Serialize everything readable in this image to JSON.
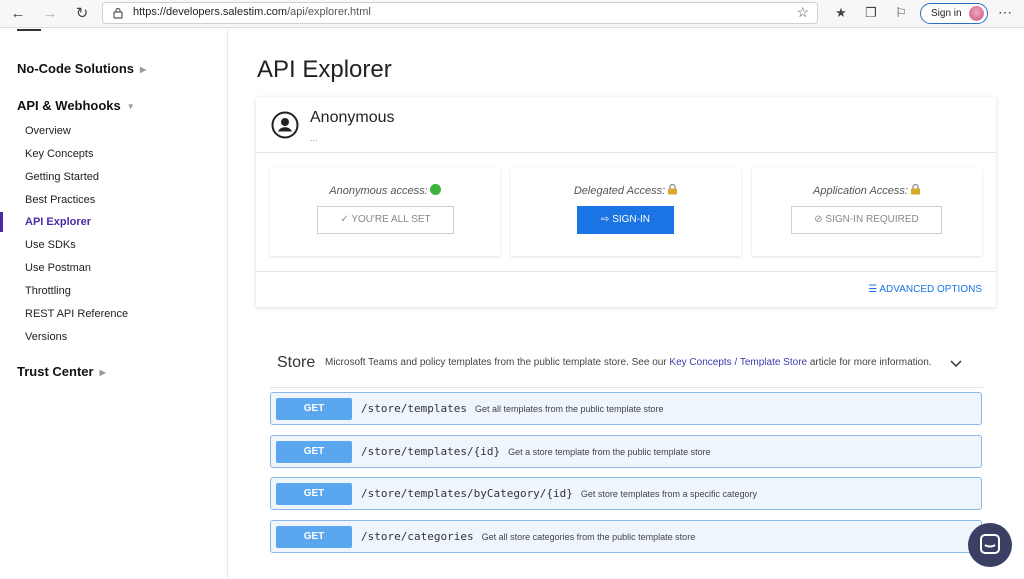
{
  "browser": {
    "url_host": "https://developers.salestim.com",
    "url_path": "/api/explorer.html",
    "signin_label": "Sign in"
  },
  "sidebar": {
    "sections": [
      {
        "label": "No-Code Solutions"
      },
      {
        "label": "API & Webhooks"
      },
      {
        "label": "Trust Center"
      }
    ],
    "items": [
      {
        "label": "Overview"
      },
      {
        "label": "Key Concepts"
      },
      {
        "label": "Getting Started"
      },
      {
        "label": "Best Practices"
      },
      {
        "label": "API Explorer",
        "active": true
      },
      {
        "label": "Use SDKs"
      },
      {
        "label": "Use Postman"
      },
      {
        "label": "Throttling"
      },
      {
        "label": "REST API Reference"
      },
      {
        "label": "Versions"
      }
    ]
  },
  "main": {
    "title": "API Explorer",
    "user": {
      "name": "Anonymous",
      "sub": "..."
    },
    "access": [
      {
        "label": "Anonymous access:",
        "button": "YOU'RE ALL SET",
        "icon": "check-icon"
      },
      {
        "label": "Delegated Access:",
        "button": "SIGN-IN",
        "icon": "sign-in-icon"
      },
      {
        "label": "Application Access:",
        "button": "SIGN-IN REQUIRED",
        "icon": "prohibited-icon"
      }
    ],
    "advanced_options": "ADVANCED OPTIONS",
    "store": {
      "title": "Store",
      "desc_before": "Microsoft Teams and policy templates from the public template store. See our ",
      "link": "Key Concepts / Template Store",
      "desc_after": " article for more information."
    },
    "endpoints": [
      {
        "method": "GET",
        "path": "/store/templates",
        "desc": "Get all templates from the public template store"
      },
      {
        "method": "GET",
        "path": "/store/templates/{id}",
        "desc": "Get a store template from the public template store"
      },
      {
        "method": "GET",
        "path": "/store/templates/byCategory/{id}",
        "desc": "Get store templates from a specific category"
      },
      {
        "method": "GET",
        "path": "/store/categories",
        "desc": "Get all store categories from the public template store"
      }
    ]
  },
  "colors": {
    "accent": "#1b74e4",
    "sidebar_active": "#4b2aa8",
    "get_badge": "#5aa7f0"
  }
}
